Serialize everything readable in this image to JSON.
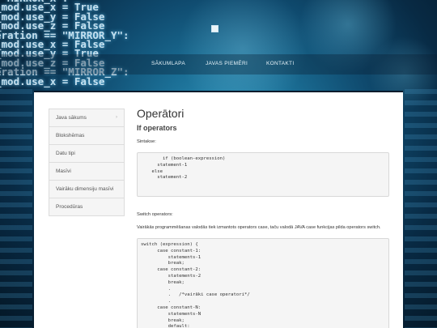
{
  "background_code": [
    "  MIRROR_X\":",
    "_mod.use_x = True",
    "_mod.use_y = False",
    "_mod.use_z = False",
    "eration == \"MIRROR_Y\":",
    "_mod.use_x = False",
    "_mod.use_y = True",
    "_mod.use_z = False",
    "eration == \"MIRROR_Z\":",
    "_mod.use_x = False"
  ],
  "nav": {
    "items": [
      "Sākumlapa",
      "Javas piemēri",
      "Kontakti"
    ]
  },
  "sidebar": {
    "items": [
      {
        "label": "Java sākums"
      },
      {
        "label": "Blokshēmas"
      },
      {
        "label": "Datu tipi"
      },
      {
        "label": "Masīvi"
      },
      {
        "label": "Vairāku dimensiju masīvi"
      },
      {
        "label": "Procedūras"
      }
    ],
    "chevron": "›"
  },
  "main": {
    "title": "Operātori",
    "subtitle": "If operators",
    "syntax_label": "Sintakse:",
    "if_code": "        if (boolean-expression)\n      statement-1\n    else\n      statement-2",
    "switch_label": "Switch operators:",
    "switch_desc": "Vairākās programmēšanas valodās tiek izmantots operators case, taču valodā JAVA case funkcijas pilda operators switch.",
    "switch_code": "switch (expression) {\n      case constant-1:\n          statements-1\n          break;\n      case constant-2:\n          statements-2\n          break;\n          .\n          .   /*vairāki case operatori*/\n          .\n      case constant-N:\n          statements-N\n          break;\n          default:"
  },
  "colors": {
    "accent": "#1b6f96",
    "panel": "#ffffff",
    "sidebar_bg": "#f5f5f5"
  }
}
